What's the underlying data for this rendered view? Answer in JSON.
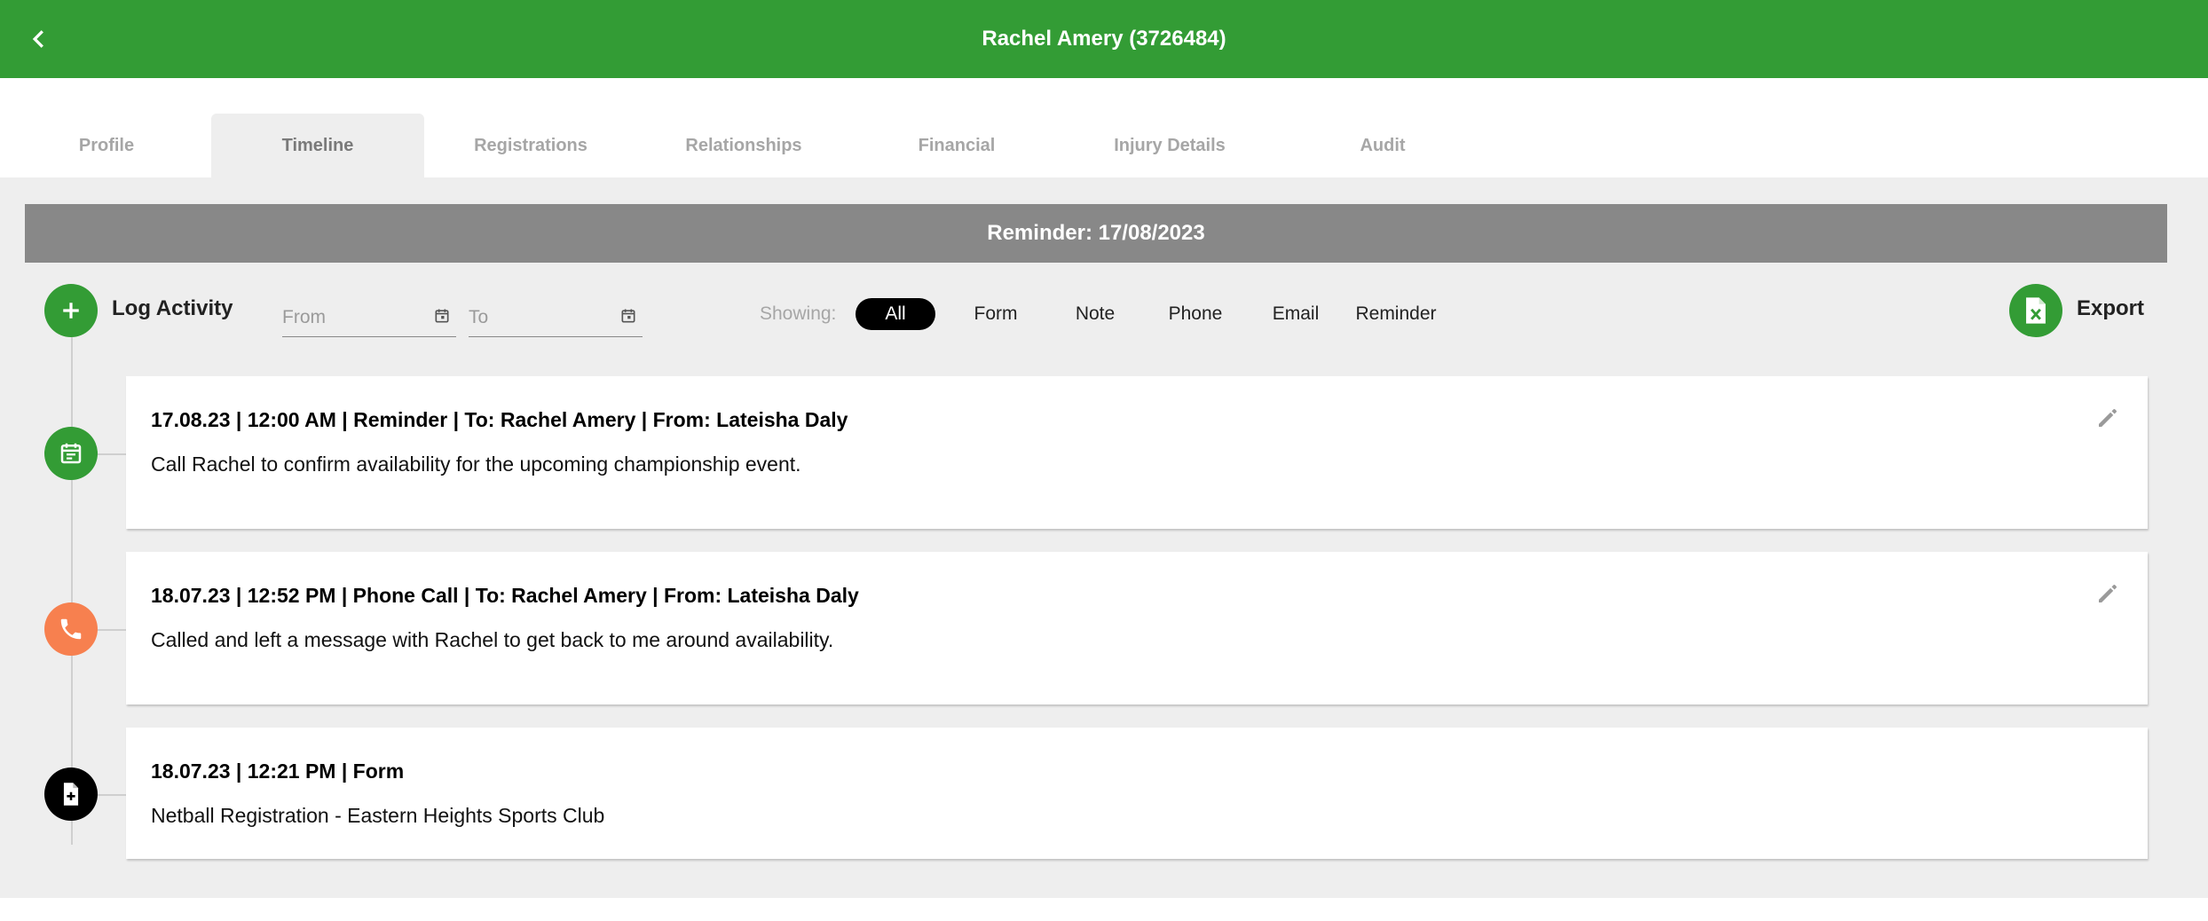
{
  "header": {
    "title": "Rachel Amery (3726484)",
    "back_icon": "chevron-left-icon"
  },
  "tabs": [
    {
      "label": "Profile",
      "active": false
    },
    {
      "label": "Timeline",
      "active": true
    },
    {
      "label": "Registrations",
      "active": false
    },
    {
      "label": "Relationships",
      "active": false
    },
    {
      "label": "Financial",
      "active": false
    },
    {
      "label": "Injury Details",
      "active": false
    },
    {
      "label": "Audit",
      "active": false
    }
  ],
  "reminder_bar": {
    "text": "Reminder: 17/08/2023"
  },
  "toolbar": {
    "log_activity_label": "Log Activity",
    "from_placeholder": "From",
    "to_placeholder": "To",
    "showing_label": "Showing:",
    "filters": [
      {
        "label": "All",
        "active": true
      },
      {
        "label": "Form",
        "active": false
      },
      {
        "label": "Note",
        "active": false
      },
      {
        "label": "Phone",
        "active": false
      },
      {
        "label": "Email",
        "active": false
      },
      {
        "label": "Reminder",
        "active": false
      }
    ],
    "export_label": "Export"
  },
  "timeline": [
    {
      "type": "reminder",
      "icon": "calendar-icon",
      "color": "#339c35",
      "header": "17.08.23 | 12:00 AM | Reminder | To: Rachel Amery | From: Lateisha Daly",
      "body": "Call Rachel to confirm availability for the upcoming championship event.",
      "editable": true
    },
    {
      "type": "phone",
      "icon": "phone-icon",
      "color": "#f7804f",
      "header": "18.07.23 | 12:52 PM | Phone Call | To: Rachel Amery | From: Lateisha Daly",
      "body": "Called and left a message with Rachel to get back to me around availability.",
      "editable": true
    },
    {
      "type": "form",
      "icon": "form-document-icon",
      "color": "#000000",
      "header": "18.07.23 | 12:21 PM | Form",
      "body": "Netball Registration - Eastern Heights Sports Club",
      "editable": false
    }
  ],
  "colors": {
    "brand_green": "#339c35",
    "reminder_bar_gray": "#888888",
    "content_bg": "#eeeeee",
    "phone_orange": "#f7804f"
  }
}
